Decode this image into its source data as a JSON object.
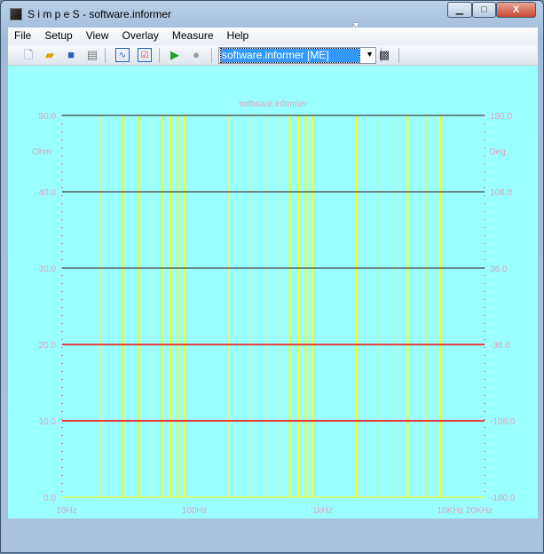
{
  "window": {
    "title": "S i m p e S - software.informer",
    "minimize": "▁",
    "maximize": "□",
    "close": "X"
  },
  "menu": [
    "File",
    "Setup",
    "View",
    "Overlay",
    "Measure",
    "Help"
  ],
  "toolbar": {
    "icons": [
      "new-file-icon",
      "open-folder-icon",
      "save-icon",
      "print-icon",
      "graph-icon",
      "checklist-icon",
      "play-icon",
      "record-icon",
      "chip-icon"
    ],
    "combo_value": "software.informer [ME]"
  },
  "colors": {
    "background": "#99ffff",
    "label": "#e0a0c0",
    "major_grid": "#ff0000",
    "freq_grid": "#ffff00"
  },
  "chart_data": {
    "type": "line",
    "title": "software.informer",
    "x_scale": "log",
    "xlim": [
      10,
      20000
    ],
    "x_tick_labels": [
      "10Hz",
      "100Hz",
      "1kHz",
      "10KHz",
      "20KHz"
    ],
    "x_ticks": [
      10,
      100,
      1000,
      10000,
      20000
    ],
    "left_axis": {
      "label": "Ohm",
      "ylim": [
        0,
        50
      ],
      "ticks": [
        "0.0",
        "10.0",
        "20.0",
        "30.0",
        "40.0",
        "50.0"
      ]
    },
    "right_axis": {
      "label": "Deg.",
      "ylim": [
        -180,
        180
      ],
      "ticks": [
        "-180.0",
        "-108.0",
        "-36.0",
        "36.0",
        "108.0",
        "180.0"
      ]
    },
    "highlighted_frequencies": [
      30,
      40,
      60,
      70,
      80,
      90,
      600,
      700,
      800,
      900,
      2000,
      5000,
      9000
    ],
    "series": []
  }
}
